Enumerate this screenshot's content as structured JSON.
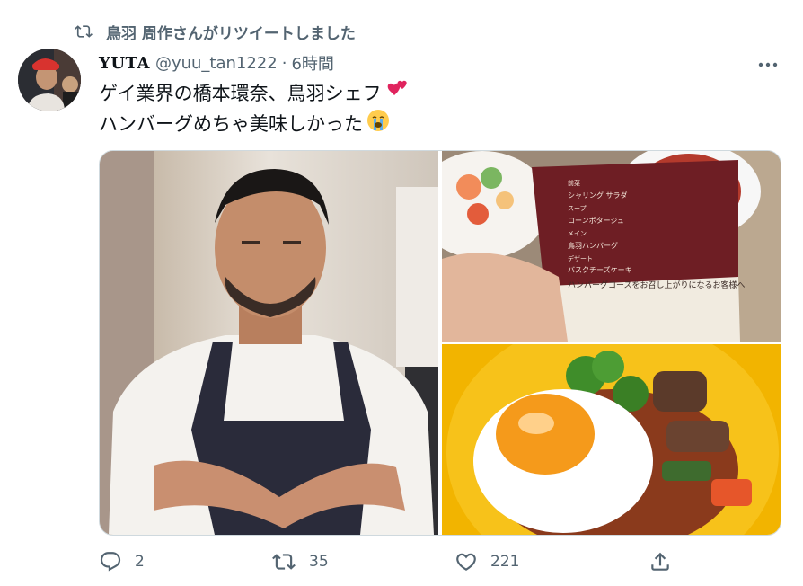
{
  "retweet": {
    "label": "鳥羽 周作さんがリツイートしました"
  },
  "tweet": {
    "display_name": "YUTA",
    "handle": "@yuu_tan1222",
    "separator": "·",
    "time": "6時間",
    "text_line1": "ゲイ業界の橋本環奈、鳥羽シェフ",
    "text_line2": "ハンバーグめちゃ美味しかった"
  },
  "media": {
    "menu_card": {
      "items": [
        "前菜",
        "シャリング サラダ",
        "スープ",
        "コーンポタージュ",
        "メイン",
        "鳥羽ハンバーグ",
        "デザート",
        "バスクチーズケーキ"
      ],
      "bottom_text": "ハンバーグコースをお召し上がりになるお客様へ"
    }
  },
  "actions": {
    "reply_count": "2",
    "retweet_count": "35",
    "like_count": "221"
  },
  "colors": {
    "secondary_text": "#536471",
    "border": "#cfd9de"
  }
}
